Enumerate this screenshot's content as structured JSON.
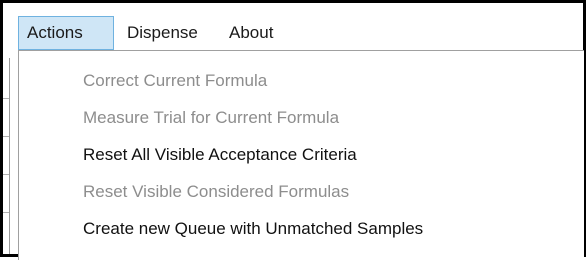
{
  "menubar": {
    "items": [
      {
        "label": "Actions",
        "state": "open"
      },
      {
        "label": "Dispense"
      },
      {
        "label": "About"
      }
    ]
  },
  "actions_menu": {
    "items": [
      {
        "label": "Correct Current Formula",
        "enabled": false
      },
      {
        "label": "Measure Trial for Current Formula",
        "enabled": false
      },
      {
        "label": "Reset All Visible Acceptance Criteria",
        "enabled": true
      },
      {
        "label": "Reset Visible Considered Formulas",
        "enabled": false
      },
      {
        "label": "Create new Queue with Unmatched Samples",
        "enabled": true
      }
    ]
  },
  "colors": {
    "highlight_bg": "#cfe6f6",
    "highlight_border": "#6fb2e0",
    "disabled_text": "#8d8d8d",
    "enabled_text": "#111111"
  }
}
